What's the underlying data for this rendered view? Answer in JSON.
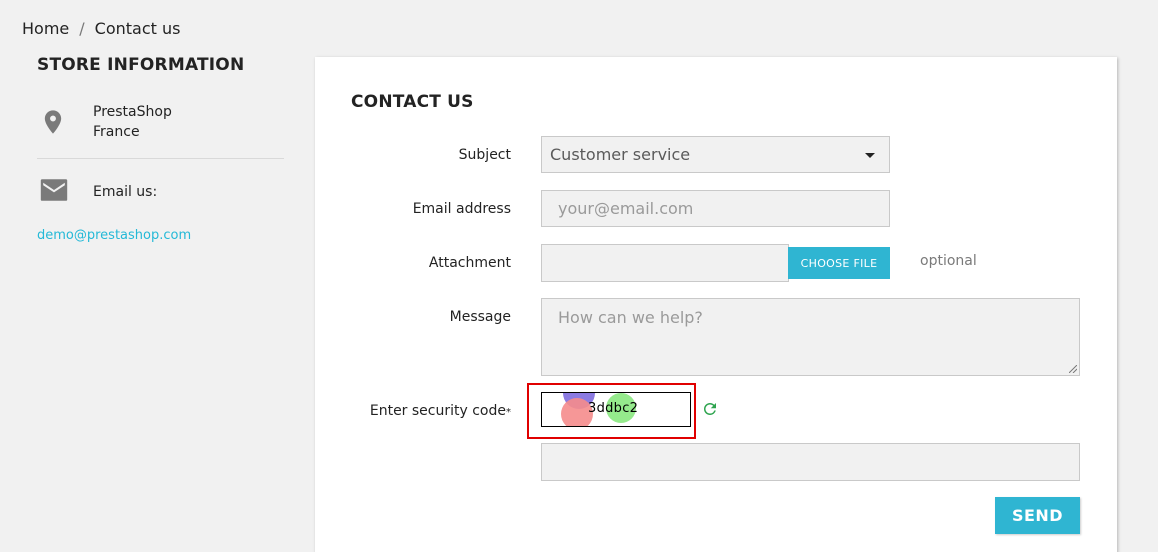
{
  "breadcrumb": {
    "home": "Home",
    "separator": "/",
    "current": "Contact us"
  },
  "sidebar": {
    "title": "STORE INFORMATION",
    "store_name": "PrestaShop",
    "store_country": "France",
    "email_label": "Email us:",
    "email": "demo@prestashop.com",
    "icons": [
      "map-marker-icon",
      "envelope-icon"
    ]
  },
  "form": {
    "title": "CONTACT US",
    "subject_label": "Subject",
    "subject_value": "Customer service",
    "email_label": "Email address",
    "email_placeholder": "your@email.com",
    "attachment_label": "Attachment",
    "choose_file_label": "CHOOSE FILE",
    "optional_label": "optional",
    "message_label": "Message",
    "message_placeholder": "How can we help?",
    "captcha_label": "Enter security code",
    "captcha_required_mark": "*",
    "captcha_code": "3ddbc2",
    "send_label": "SEND"
  },
  "colors": {
    "accent": "#2fb5d2",
    "link": "#24b9d7",
    "captcha_border": "#e00000",
    "refresh": "#2ea44f"
  }
}
